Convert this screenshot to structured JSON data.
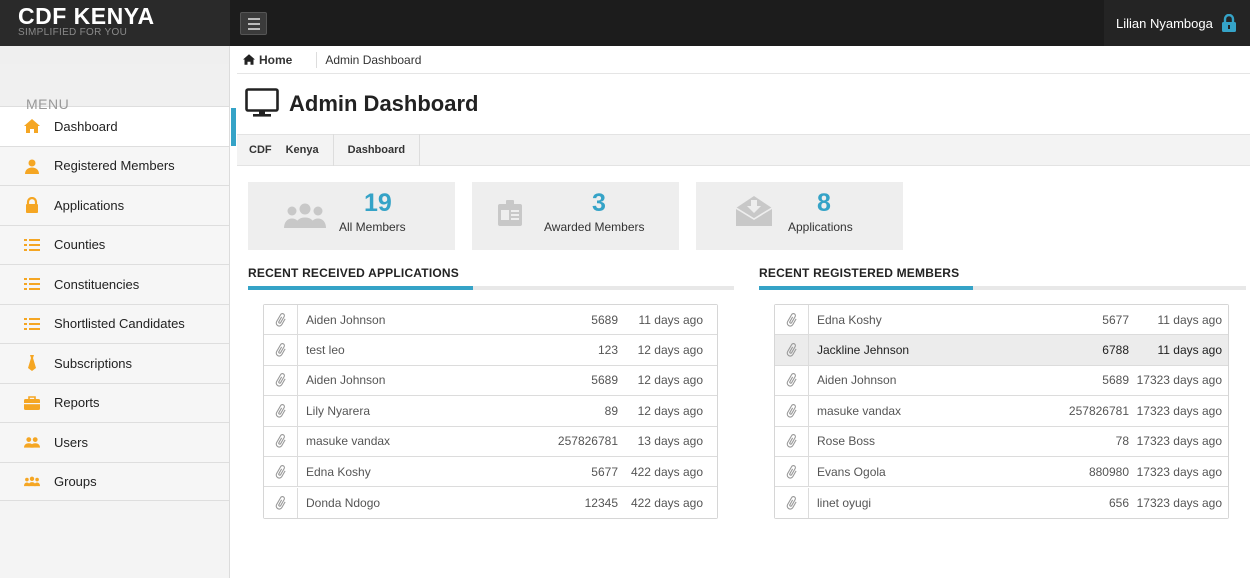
{
  "brand": {
    "name": "CDF KENYA",
    "tagline": "SIMPLIFIED FOR YOU"
  },
  "user": {
    "name": "Lilian Nyamboga"
  },
  "sidebar": {
    "title": "MENU",
    "items": [
      {
        "label": "Dashboard",
        "icon": "home-icon",
        "active": true
      },
      {
        "label": "Registered Members",
        "icon": "user-icon"
      },
      {
        "label": "Applications",
        "icon": "lock-icon"
      },
      {
        "label": "Counties",
        "icon": "list-icon"
      },
      {
        "label": "Constituencies",
        "icon": "list-icon"
      },
      {
        "label": "Shortlisted Candidates",
        "icon": "list-icon"
      },
      {
        "label": "Subscriptions",
        "icon": "tie-icon"
      },
      {
        "label": "Reports",
        "icon": "briefcase-icon"
      },
      {
        "label": "Users",
        "icon": "users-icon"
      },
      {
        "label": "Groups",
        "icon": "group-icon"
      }
    ]
  },
  "breadcrumb": {
    "home": "Home",
    "current": "Admin Dashboard"
  },
  "page": {
    "title": "Admin Dashboard"
  },
  "subnav": {
    "a": "CDF",
    "b": "Kenya",
    "c": "Dashboard"
  },
  "stats": [
    {
      "value": "19",
      "label": "All Members",
      "icon": "group-icon"
    },
    {
      "value": "3",
      "label": "Awarded Members",
      "icon": "id-card-icon"
    },
    {
      "value": "8",
      "label": "Applications",
      "icon": "envelope-download-icon"
    }
  ],
  "applications": {
    "title": "RECENT RECEIVED APPLICATIONS",
    "rows": [
      {
        "name": "Aiden Johnson",
        "num": "5689",
        "when": "11 days ago"
      },
      {
        "name": "test leo",
        "num": "123",
        "when": "12 days ago"
      },
      {
        "name": "Aiden Johnson",
        "num": "5689",
        "when": "12 days ago"
      },
      {
        "name": "Lily Nyarera",
        "num": "89",
        "when": "12 days ago"
      },
      {
        "name": "masuke vandax",
        "num": "257826781",
        "when": "13 days ago"
      },
      {
        "name": "Edna Koshy",
        "num": "5677",
        "when": "422 days ago"
      },
      {
        "name": "Donda Ndogo",
        "num": "12345",
        "when": "422 days ago"
      }
    ]
  },
  "members": {
    "title": "RECENT REGISTERED MEMBERS",
    "rows": [
      {
        "name": "Edna Koshy",
        "num": "5677",
        "when": "11 days ago"
      },
      {
        "name": "Jackline Jehnson",
        "num": "6788",
        "when": "11 days ago"
      },
      {
        "name": "Aiden Johnson",
        "num": "5689",
        "when": "17323 days ago"
      },
      {
        "name": "masuke vandax",
        "num": "257826781",
        "when": "17323 days ago"
      },
      {
        "name": "Rose Boss",
        "num": "78",
        "when": "17323 days ago"
      },
      {
        "name": "Evans Ogola",
        "num": "880980",
        "when": "17323 days ago"
      },
      {
        "name": "linet oyugi",
        "num": "656",
        "when": "17323 days ago"
      }
    ]
  },
  "colors": {
    "accent": "#35a3c7",
    "icon": "#f5a623",
    "topbar": "#1c1c1c"
  }
}
